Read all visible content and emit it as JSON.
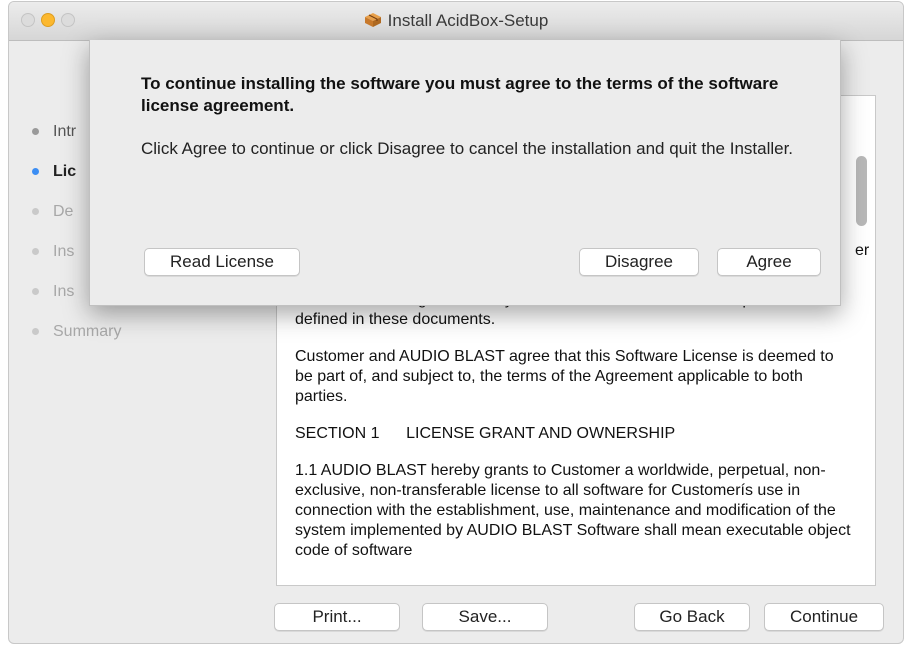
{
  "window": {
    "title": "Install AcidBox-Setup"
  },
  "steps": [
    {
      "label": "Intr",
      "state": "done"
    },
    {
      "label": "Lic",
      "state": "current"
    },
    {
      "label": "De",
      "state": "pending"
    },
    {
      "label": "Ins",
      "state": "pending"
    },
    {
      "label": "Ins",
      "state": "pending"
    },
    {
      "label": "Summary",
      "state": "pending"
    }
  ],
  "dialog": {
    "heading": "To continue installing the software you must agree to the terms of the software license agreement.",
    "message": "Click Agree to continue or click Disagree to cancel the installation and quit the Installer.",
    "read_license": "Read License",
    "disagree": "Disagree",
    "agree": "Agree"
  },
  "license": {
    "paragraphs": [
      "documents and agreement. System shall mean the deliverable product as defined in these documents.",
      "Customer and AUDIO BLAST agree that this Software License is deemed to be part of, and subject to, the terms of the Agreement applicable to both parties.",
      "SECTION 1      LICENSE GRANT AND OWNERSHIP",
      "1.1   AUDIO BLAST hereby grants to Customer a worldwide, perpetual, non-exclusive, non-transferable license to all software for Customerís use in connection with the establishment, use, maintenance and modification of the system implemented by AUDIO BLAST Software shall mean executable object code of software"
    ],
    "partial_right_char": "er"
  },
  "buttons": {
    "print": "Print...",
    "save": "Save...",
    "go_back": "Go Back",
    "continue": "Continue"
  },
  "colors": {
    "current_step_dot": "#3c8ef3",
    "minimize_light": "#fcb82e"
  },
  "icons": {
    "title_icon": "package-icon"
  }
}
